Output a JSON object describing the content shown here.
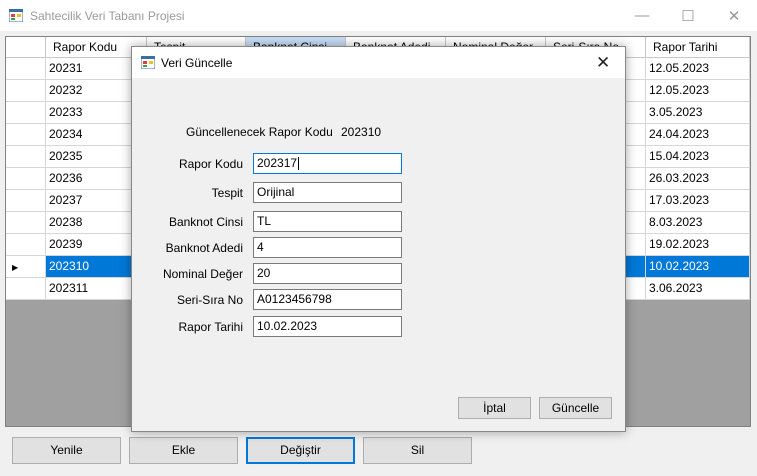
{
  "app": {
    "title": "Sahtecilik Veri Tabanı Projesi"
  },
  "window_controls": {
    "minimize": "—",
    "maximize": "☐",
    "close": "✕"
  },
  "grid": {
    "columns": [
      "Rapor Kodu",
      "Tespit",
      "Banknot Cinsi",
      "Banknot Adedi",
      "Nominal Değer",
      "Seri-Sıra No",
      "Rapor Tarihi"
    ],
    "rows": [
      {
        "rapor_kodu": "20231",
        "rapor_tarihi": "12.05.2023"
      },
      {
        "rapor_kodu": "20232",
        "rapor_tarihi": "12.05.2023"
      },
      {
        "rapor_kodu": "20233",
        "rapor_tarihi": "3.05.2023"
      },
      {
        "rapor_kodu": "20234",
        "rapor_tarihi": "24.04.2023"
      },
      {
        "rapor_kodu": "20235",
        "rapor_tarihi": "15.04.2023"
      },
      {
        "rapor_kodu": "20236",
        "rapor_tarihi": "26.03.2023"
      },
      {
        "rapor_kodu": "20237",
        "rapor_tarihi": "17.03.2023"
      },
      {
        "rapor_kodu": "20238",
        "rapor_tarihi": "8.03.2023"
      },
      {
        "rapor_kodu": "20239",
        "rapor_tarihi": "19.02.2023"
      },
      {
        "rapor_kodu": "202310",
        "rapor_tarihi": "10.02.2023"
      },
      {
        "rapor_kodu": "202311",
        "rapor_tarihi": "3.06.2023"
      }
    ],
    "row_pointer": "▶"
  },
  "bottom_buttons": {
    "yenile": "Yenile",
    "ekle": "Ekle",
    "degistir": "Değiştir",
    "sil": "Sil"
  },
  "dialog": {
    "title": "Veri Güncelle",
    "close": "✕",
    "target_label": "Güncellenecek Rapor Kodu",
    "target_value": "202310",
    "fields": {
      "rapor_kodu": {
        "label": "Rapor Kodu",
        "value": "202317"
      },
      "tespit": {
        "label": "Tespit",
        "value": "Orijinal"
      },
      "banknot_cinsi": {
        "label": "Banknot Cinsi",
        "value": "TL"
      },
      "banknot_adedi": {
        "label": "Banknot Adedi",
        "value": "4"
      },
      "nominal_deger": {
        "label": "Nominal Değer",
        "value": "20"
      },
      "seri_sira_no": {
        "label": "Seri-Sıra No",
        "value": "A0123456798"
      },
      "rapor_tarihi": {
        "label": "Rapor Tarihi",
        "value": "10.02.2023"
      }
    },
    "buttons": {
      "iptal": "İptal",
      "guncelle": "Güncelle"
    }
  }
}
